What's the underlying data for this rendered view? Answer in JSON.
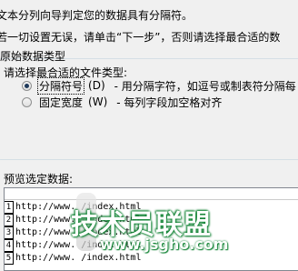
{
  "intro": {
    "line1": "文本分列向导判定您的数据具有分隔符。",
    "line2": "若一切设置无误，请单击“下一步”，否则请选择最合适的数"
  },
  "original_data_type": {
    "title": "原始数据类型",
    "prompt": "请选择最合适的文件类型:",
    "options": [
      {
        "label": "分隔符号",
        "key": "(D)",
        "desc": "- 用分隔字符，如逗号或制表符分隔每",
        "selected": true
      },
      {
        "label": "固定宽度",
        "key": "(W)",
        "desc": "- 每列字段加空格对齐",
        "selected": false
      }
    ]
  },
  "preview": {
    "label": "预览选定数据:",
    "rows": [
      {
        "num": "1",
        "text": "http://www.      /index.html"
      },
      {
        "num": "2",
        "text": "http://www.      /index.html"
      },
      {
        "num": "3",
        "text": "http://www.      /index.html"
      },
      {
        "num": "4",
        "text": "http://www.      /index.html"
      },
      {
        "num": "5",
        "text": "http://www.      /index.html"
      }
    ]
  },
  "watermark": {
    "title": "技术员联盟",
    "url": "www.jsgho.com"
  }
}
